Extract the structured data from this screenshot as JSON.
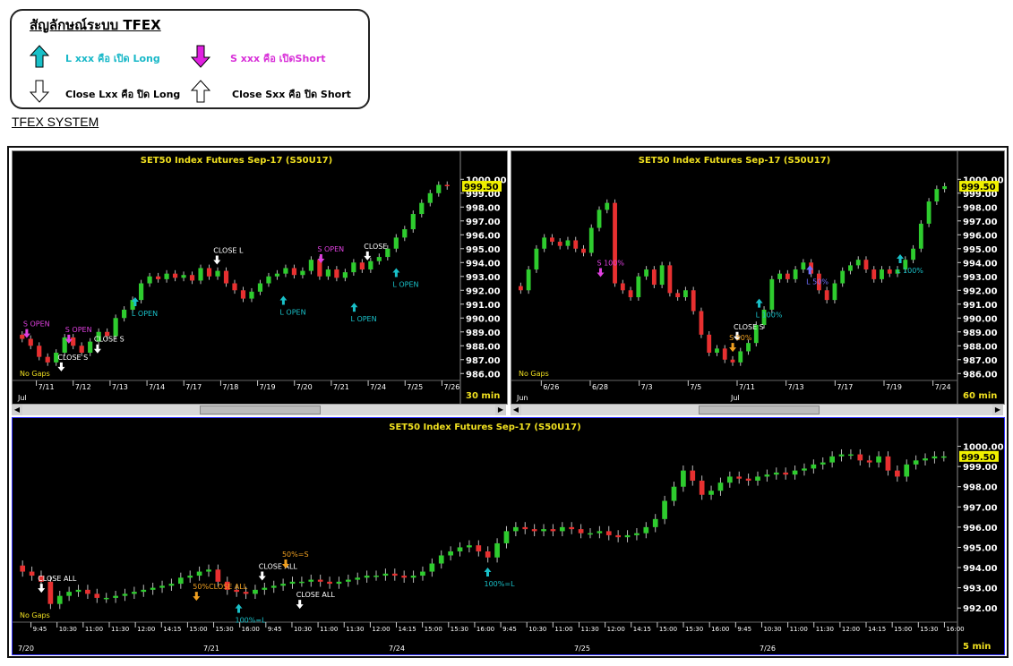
{
  "legend": {
    "title": "สัญลักษณ์ระบบ TFEX",
    "long_open": "L xxx คือ เปิด Long",
    "short_open": "S xxx คือ เปิดShort",
    "close_long": "Close Lxx คือ ปิด Long",
    "close_short": "Close Sxx คือ ปิด Short"
  },
  "system_label": "TFEX SYSTEM",
  "colors": {
    "up": "#2ecc2e",
    "down": "#e83030",
    "long": "#19c0c8",
    "short": "#e040e0",
    "close": "#ffffff",
    "orange": "#f0a020",
    "title": "#f0e020"
  },
  "chart_data": [
    {
      "type": "candlestick",
      "title": "SET50  Index  Futures  Sep-17  (S50U17)",
      "timeframe": "30  min",
      "last_price": "999.50",
      "ylim": [
        985.5,
        1000.6
      ],
      "yticks": [
        "1000.00",
        "999.00",
        "998.00",
        "997.00",
        "996.00",
        "995.00",
        "994.00",
        "993.00",
        "992.00",
        "991.00",
        "990.00",
        "989.00",
        "988.00",
        "987.00",
        "986.00"
      ],
      "xticks": [
        "7/11",
        "7/12",
        "7/13",
        "7/14",
        "7/17",
        "7/18",
        "7/19",
        "7/20",
        "7/21",
        "7/24",
        "7/25",
        "7/26"
      ],
      "month_label": "Jul",
      "note": "No Gaps",
      "series": [
        988.5,
        988.0,
        987.2,
        986.8,
        987.5,
        988.6,
        988.0,
        987.5,
        988.3,
        989.0,
        988.7,
        990.0,
        990.6,
        991.3,
        992.5,
        993.0,
        992.8,
        993.2,
        992.9,
        993.1,
        992.7,
        993.6,
        993.0,
        993.4,
        992.5,
        992.0,
        991.4,
        991.9,
        992.5,
        993.0,
        993.2,
        993.6,
        993.1,
        993.4,
        994.2,
        993.0,
        993.5,
        992.9,
        993.3,
        994.0,
        993.5,
        994.1,
        994.4,
        995.0,
        995.8,
        996.4,
        997.5,
        998.3,
        999.0,
        999.6,
        999.5
      ],
      "signals": [
        {
          "label": "S  OPEN",
          "kind": "short",
          "x": 0.02,
          "y": 989.2
        },
        {
          "label": "S  OPEN",
          "kind": "short",
          "x": 0.115,
          "y": 988.8
        },
        {
          "label": "CLOSE  S",
          "kind": "close",
          "x": 0.098,
          "y": 986.8
        },
        {
          "label": "CLOSE  S",
          "kind": "close",
          "x": 0.18,
          "y": 988.1
        },
        {
          "label": "L  OPEN",
          "kind": "long",
          "x": 0.265,
          "y": 991.5
        },
        {
          "label": "CLOSE  L",
          "kind": "close",
          "x": 0.45,
          "y": 994.5
        },
        {
          "label": "L  OPEN",
          "kind": "long",
          "x": 0.6,
          "y": 991.6
        },
        {
          "label": "S  OPEN",
          "kind": "short",
          "x": 0.685,
          "y": 994.6
        },
        {
          "label": "L  OPEN",
          "kind": "long",
          "x": 0.76,
          "y": 991.1
        },
        {
          "label": "CLOSE",
          "kind": "close",
          "x": 0.79,
          "y": 994.8
        },
        {
          "label": "L  OPEN",
          "kind": "long",
          "x": 0.855,
          "y": 993.6
        }
      ]
    },
    {
      "type": "candlestick",
      "title": "SET50  Index  Futures  Sep-17  (S50U17)",
      "timeframe": "60  min",
      "last_price": "999.50",
      "ylim": [
        985.5,
        1000.6
      ],
      "yticks": [
        "1000.00",
        "999.00",
        "998.00",
        "997.00",
        "996.00",
        "995.00",
        "994.00",
        "993.00",
        "992.00",
        "991.00",
        "990.00",
        "989.00",
        "988.00",
        "987.00",
        "986.00"
      ],
      "xticks": [
        "6/26",
        "6/28",
        "7/3",
        "7/5",
        "7/11",
        "7/13",
        "7/17",
        "7/19",
        "7/24"
      ],
      "month_labels": [
        "Jun",
        "Jul"
      ],
      "note": "No Gaps",
      "series": [
        992.0,
        993.5,
        995.0,
        995.8,
        995.5,
        995.2,
        995.6,
        995.0,
        994.7,
        996.5,
        997.8,
        998.3,
        992.5,
        992.0,
        991.5,
        993.0,
        993.5,
        992.4,
        993.8,
        991.8,
        991.5,
        992.0,
        990.5,
        988.8,
        987.5,
        987.8,
        987.0,
        986.8,
        987.6,
        988.2,
        989.5,
        990.6,
        992.8,
        993.2,
        992.8,
        993.5,
        994.0,
        993.2,
        992.0,
        991.3,
        992.5,
        993.4,
        993.8,
        994.2,
        993.5,
        992.8,
        993.5,
        993.2,
        993.5,
        994.2,
        995.0,
        996.8,
        998.4,
        999.3,
        999.5
      ],
      "signals": [
        {
          "label": "S  100%",
          "kind": "short",
          "x": 0.19,
          "y": 993.6
        },
        {
          "label": "CLOSE  S",
          "kind": "close",
          "x": 0.5,
          "y": 989.0
        },
        {
          "label": "S  50%",
          "kind": "orange",
          "x": 0.49,
          "y": 988.2
        },
        {
          "label": "L  100%",
          "kind": "long",
          "x": 0.55,
          "y": 991.4
        },
        {
          "label": "L  50%",
          "kind": "long_blue",
          "x": 0.665,
          "y": 993.8
        },
        {
          "label": "L  100%",
          "kind": "long",
          "x": 0.87,
          "y": 994.6
        }
      ]
    },
    {
      "type": "candlestick",
      "title": "SET50  Index  Futures  Sep-17  (S50U17)",
      "timeframe": "5  min",
      "last_price": "999.50",
      "ylim": [
        991.3,
        1000.6
      ],
      "yticks": [
        "1000.00",
        "999.00",
        "998.00",
        "997.00",
        "996.00",
        "995.00",
        "994.00",
        "993.00",
        "992.00"
      ],
      "xticks": [
        "9:45",
        "10:30",
        "11:00",
        "11:30",
        "12:00",
        "14:15",
        "15:00",
        "15:30",
        "16:00",
        "9:45",
        "10:30",
        "11:00",
        "11:30",
        "12:00",
        "14:15",
        "15:00",
        "15:30",
        "16:00",
        "9:45",
        "10:30",
        "11:00",
        "11:30",
        "12:00",
        "14:15",
        "15:00",
        "15:30",
        "16:00",
        "9:45",
        "10:30",
        "11:00",
        "11:30",
        "12:00",
        "14:15",
        "15:00",
        "15:30",
        "16:00"
      ],
      "date_labels": [
        "7/20",
        "7/21",
        "7/24",
        "7/25",
        "7/26"
      ],
      "note": "No Gaps",
      "series": [
        993.8,
        993.6,
        993.3,
        992.2,
        992.6,
        992.8,
        992.9,
        992.7,
        992.5,
        992.5,
        992.6,
        992.7,
        992.8,
        992.9,
        993.0,
        993.1,
        993.2,
        993.5,
        993.6,
        993.8,
        993.9,
        993.3,
        992.9,
        992.8,
        992.7,
        992.9,
        993.0,
        993.1,
        993.2,
        993.3,
        993.3,
        993.4,
        993.3,
        993.2,
        993.3,
        993.4,
        993.5,
        993.6,
        993.6,
        993.7,
        993.6,
        993.5,
        993.6,
        993.8,
        994.2,
        994.6,
        994.8,
        995.0,
        995.1,
        994.8,
        994.5,
        995.2,
        995.8,
        996.0,
        995.9,
        995.8,
        995.9,
        995.8,
        996.0,
        995.9,
        995.7,
        995.7,
        995.8,
        995.6,
        995.5,
        995.6,
        995.7,
        996.0,
        996.4,
        997.3,
        998.0,
        998.8,
        998.3,
        997.6,
        997.8,
        998.2,
        998.5,
        998.4,
        998.3,
        998.5,
        998.6,
        998.7,
        998.6,
        998.8,
        998.9,
        999.1,
        999.2,
        999.5,
        999.6,
        999.6,
        999.3,
        999.2,
        999.5,
        998.8,
        998.5,
        999.1,
        999.3,
        999.4,
        999.5,
        999.5
      ],
      "signals": [
        {
          "label": "CLOSE  ALL",
          "kind": "close",
          "x": 0.025,
          "y": 993.2
        },
        {
          "label": "CLOSE  ALL",
          "kind": "close",
          "x": 0.26,
          "y": 993.8
        },
        {
          "label": "50%CLOSE  ALL",
          "kind": "orange",
          "x": 0.19,
          "y": 992.8
        },
        {
          "label": "100%=L",
          "kind": "long",
          "x": 0.235,
          "y": 992.2
        },
        {
          "label": "50%=S",
          "kind": "orange",
          "x": 0.285,
          "y": 994.4
        },
        {
          "label": "CLOSE  ALL",
          "kind": "close",
          "x": 0.3,
          "y": 992.4
        },
        {
          "label": "100%=L",
          "kind": "long",
          "x": 0.5,
          "y": 994.0
        }
      ]
    }
  ]
}
